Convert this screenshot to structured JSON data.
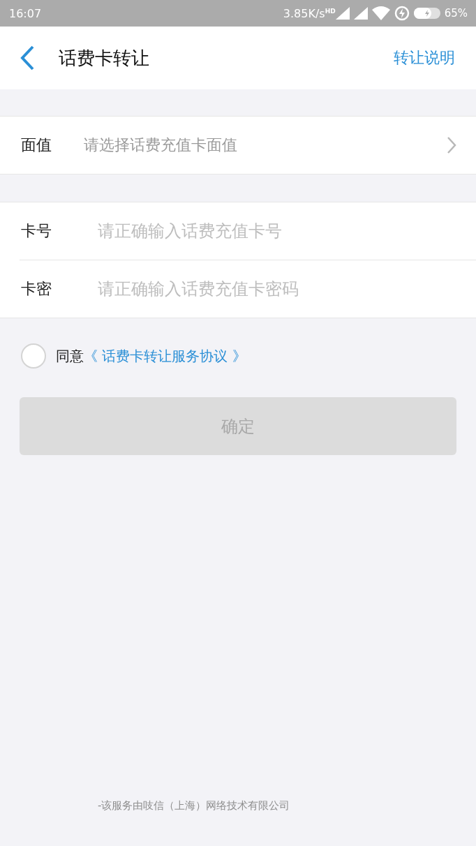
{
  "status_bar": {
    "time": "16:07",
    "network_speed": "3.85K/s",
    "network_badge": "HD",
    "battery": "65%"
  },
  "header": {
    "title": "话费卡转让",
    "action": "转让说明"
  },
  "face_value": {
    "label": "面值",
    "placeholder": "请选择话费充值卡面值"
  },
  "fields": [
    {
      "label": "卡号",
      "placeholder": "请正确输入话费充值卡号"
    },
    {
      "label": "卡密",
      "placeholder": "请正确输入话费充值卡密码"
    }
  ],
  "agreement": {
    "checked": false,
    "prefix": "同意",
    "link": "《 话费卡转让服务协议 》"
  },
  "confirm_button": {
    "label": "确定",
    "disabled": true
  },
  "footer": "-该服务由吱信（上海）网络技术有限公司"
}
